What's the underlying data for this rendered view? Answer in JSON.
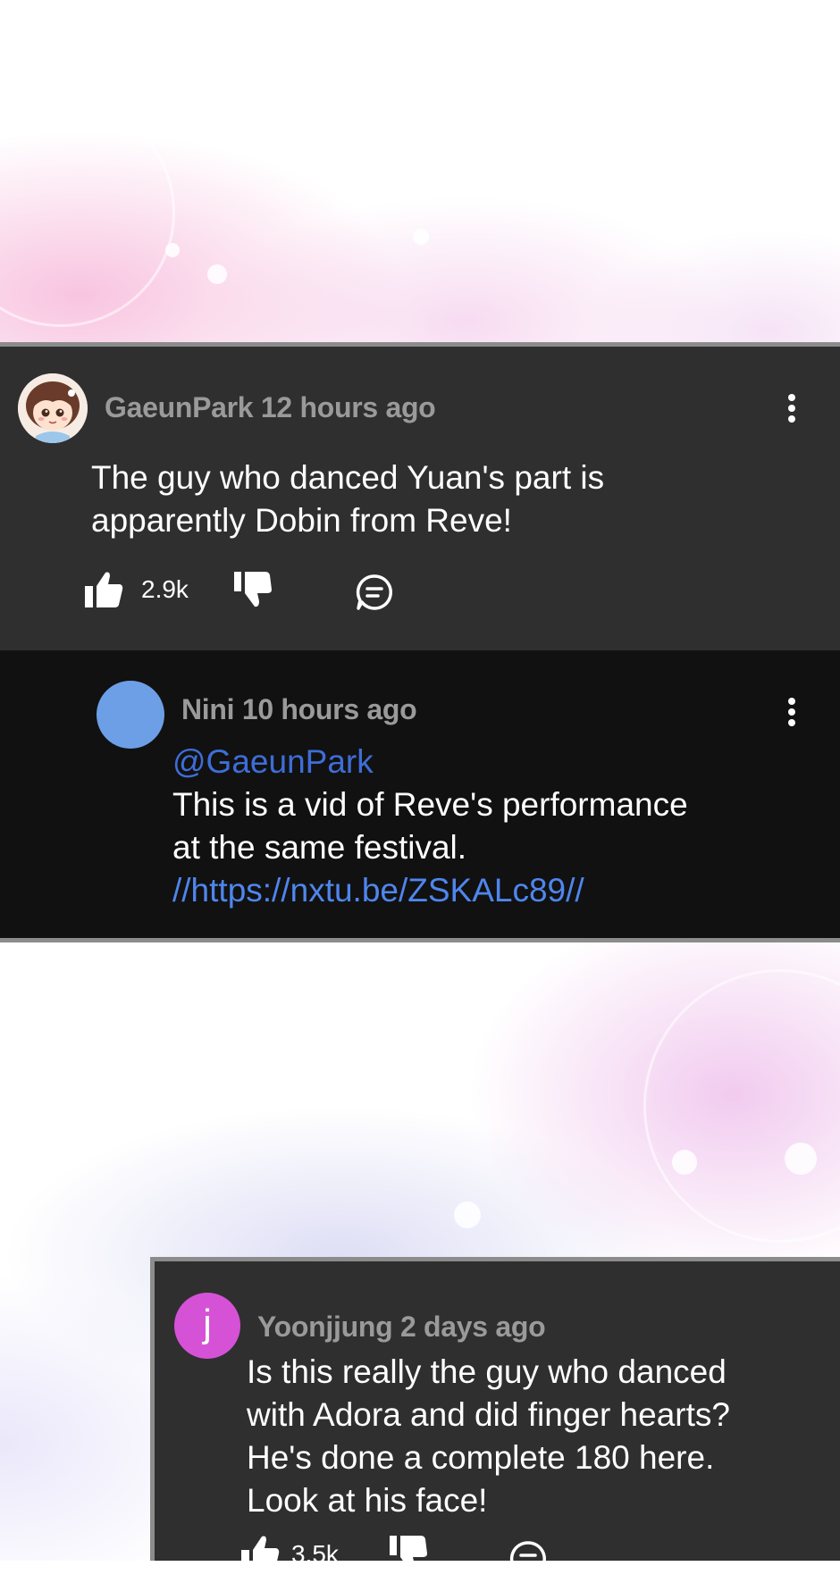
{
  "comments": [
    {
      "username": "GaeunPark",
      "time": "12 hours ago",
      "text_lines": [
        "The guy who danced Yuan's part is",
        "apparently Dobin from Reve!"
      ],
      "likes": "2.9k",
      "avatar_icon": "chibi-girl-avatar-icon"
    },
    {
      "username": "Nini",
      "time": "10 hours ago",
      "mention": "@GaeunPark",
      "text_lines": [
        "This is a vid of Reve's performance",
        "at the same festival."
      ],
      "link": "//https://nxtu.be/ZSKALc89//",
      "avatar_color": "#6d9fe6"
    },
    {
      "username": "Yoonjjung",
      "time": "2 days ago",
      "avatar_letter": "j",
      "avatar_color": "#d552d6",
      "text_lines": [
        "Is this really the guy who danced",
        "with Adora and did finger hearts?",
        "He's done a complete 180 here.",
        "Look at his face!"
      ],
      "likes": "3.5k"
    }
  ],
  "colors": {
    "card_bg": "#2f2f2f",
    "reply_bg": "#111111",
    "meta_text": "#9a9a9a",
    "mention": "#3f6dd8",
    "link": "#4f86ee"
  },
  "icons": [
    "thumbs-up-icon",
    "thumbs-down-icon",
    "reply-bubble-icon",
    "more-vertical-icon"
  ]
}
